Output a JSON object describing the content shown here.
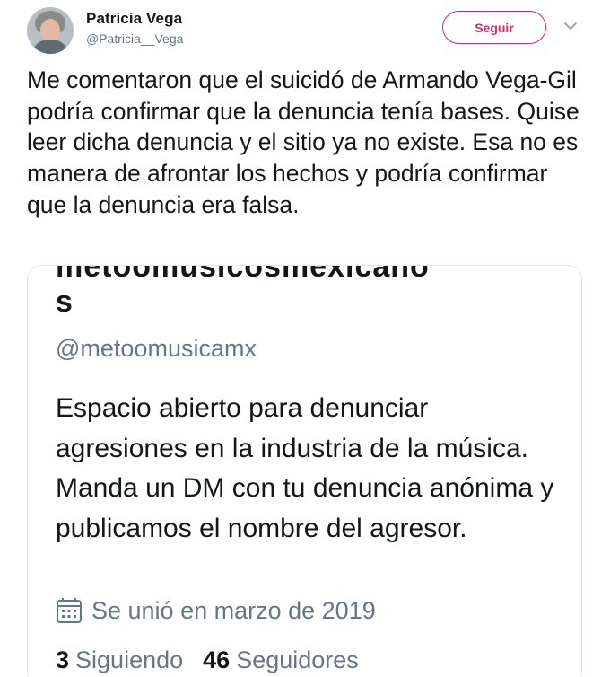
{
  "author": {
    "display_name": "Patricia Vega",
    "handle": "@Patricia__Vega",
    "follow_label": "Seguir"
  },
  "tweet": {
    "text": "Me comentaron que el suicidó de Armando Vega-Gil podría confirmar que la denuncia tenía bases. Quise leer dicha denuncia y el sitio ya no existe. Esa no es manera de afrontar los hechos y podría confirmar que la denuncia era falsa."
  },
  "embedded_profile": {
    "name_cut": "metoomusicosmexicano",
    "name_last": "s",
    "handle": "@metoomusicamx",
    "bio": "Espacio abierto para denunciar agresiones en la industria de la música. Manda un DM con tu denuncia anónima y publicamos el nombre del agresor.",
    "joined": "Se unió en marzo de 2019",
    "following_count": "3",
    "following_label": "Siguiendo",
    "followers_count": "46",
    "followers_label": "Seguidores"
  },
  "icons": {
    "avatar": "user-avatar",
    "more": "chevron-down-icon",
    "calendar": "calendar-icon"
  },
  "colors": {
    "accent": "#e0245e",
    "secondary_text": "#657786",
    "border": "#e1e8ed"
  }
}
